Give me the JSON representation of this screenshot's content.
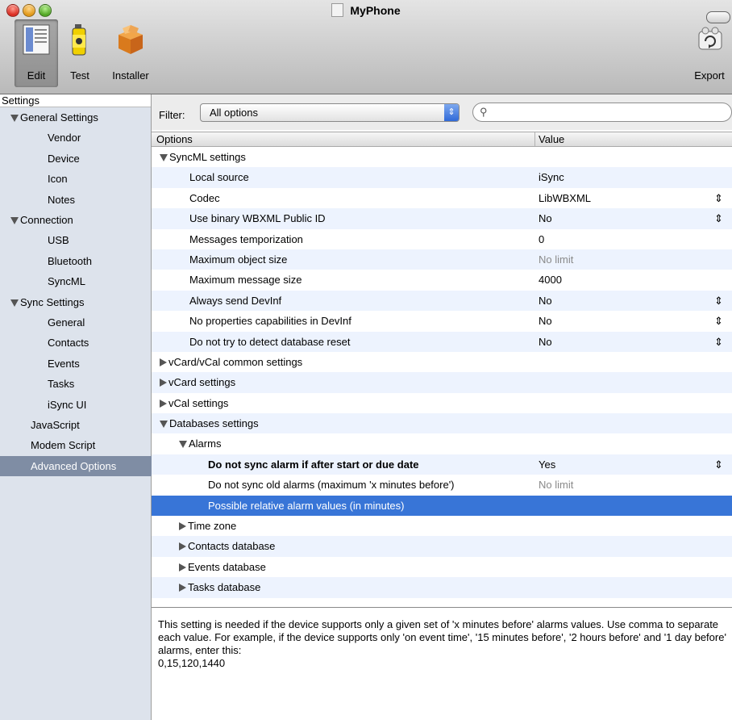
{
  "window": {
    "title": "MyPhone"
  },
  "toolbar": {
    "edit": "Edit",
    "test": "Test",
    "installer": "Installer",
    "export": "Export"
  },
  "sidebar": {
    "header": "Settings",
    "items": [
      {
        "label": "General Settings",
        "level": 0,
        "disclosure": "open"
      },
      {
        "label": "Vendor",
        "level": 1
      },
      {
        "label": "Device",
        "level": 1
      },
      {
        "label": "Icon",
        "level": 1
      },
      {
        "label": "Notes",
        "level": 1
      },
      {
        "label": "Connection",
        "level": 0,
        "disclosure": "open"
      },
      {
        "label": "USB",
        "level": 1
      },
      {
        "label": "Bluetooth",
        "level": 1
      },
      {
        "label": "SyncML",
        "level": 1
      },
      {
        "label": "Sync Settings",
        "level": 0,
        "disclosure": "open"
      },
      {
        "label": "General",
        "level": 1
      },
      {
        "label": "Contacts",
        "level": 1
      },
      {
        "label": "Events",
        "level": 1
      },
      {
        "label": "Tasks",
        "level": 1
      },
      {
        "label": "iSync UI",
        "level": 1
      },
      {
        "label": "JavaScript",
        "level": 0
      },
      {
        "label": "Modem Script",
        "level": 0
      },
      {
        "label": "Advanced Options",
        "level": 0,
        "selected": true
      }
    ]
  },
  "filter": {
    "label": "Filter:",
    "value": "All options",
    "search_placeholder": ""
  },
  "table": {
    "columns": [
      "Options",
      "Value"
    ],
    "rows": [
      {
        "name": "SyncML settings",
        "disclosure": "open",
        "indent": 0
      },
      {
        "name": "Local source",
        "value": "iSync",
        "indent": 2
      },
      {
        "name": "Codec",
        "value": "LibWBXML",
        "stepper": true,
        "indent": 2
      },
      {
        "name": "Use binary WBXML Public ID",
        "value": "No",
        "stepper": true,
        "indent": 2
      },
      {
        "name": "Messages temporization",
        "value": "0",
        "indent": 2
      },
      {
        "name": "Maximum object size",
        "value": "No limit",
        "muted": true,
        "indent": 2
      },
      {
        "name": "Maximum message size",
        "value": "4000",
        "indent": 2
      },
      {
        "name": "Always send DevInf",
        "value": "No",
        "stepper": true,
        "indent": 2
      },
      {
        "name": "No properties capabilities in DevInf",
        "value": "No",
        "stepper": true,
        "indent": 2
      },
      {
        "name": "Do not try to detect database reset",
        "value": "No",
        "stepper": true,
        "indent": 2
      },
      {
        "name": "vCard/vCal common settings",
        "disclosure": "closed",
        "indent": 0
      },
      {
        "name": "vCard settings",
        "disclosure": "closed",
        "indent": 0
      },
      {
        "name": "vCal settings",
        "disclosure": "closed",
        "indent": 0
      },
      {
        "name": "Databases settings",
        "disclosure": "open",
        "indent": 0
      },
      {
        "name": "Alarms",
        "disclosure": "open",
        "indent": 1
      },
      {
        "name": "Do not sync alarm if after start or due date",
        "value": "Yes",
        "stepper": true,
        "bold": true,
        "indent": 3
      },
      {
        "name": "Do not sync old alarms (maximum 'x minutes before')",
        "value": "No limit",
        "muted": true,
        "indent": 3
      },
      {
        "name": "Possible relative alarm values (in minutes)",
        "selected": true,
        "indent": 3
      },
      {
        "name": "Time zone",
        "disclosure": "closed",
        "indent": 1
      },
      {
        "name": "Contacts database",
        "disclosure": "closed",
        "indent": 1
      },
      {
        "name": "Events database",
        "disclosure": "closed",
        "indent": 1
      },
      {
        "name": "Tasks database",
        "disclosure": "closed",
        "indent": 1
      }
    ]
  },
  "description": "This setting is needed if the device supports only a given set of 'x minutes before' alarms values. Use comma to separate each value. For example, if the device supports only 'on event time', '15 minutes before', '2 hours before' and '1 day before' alarms, enter this:\n0,15,120,1440",
  "colors": {
    "selection": "#3875d7",
    "sidebar_bg": "#dde3ec",
    "sidebar_selected": "#7f8da4",
    "alt_row": "#edf3fe"
  }
}
